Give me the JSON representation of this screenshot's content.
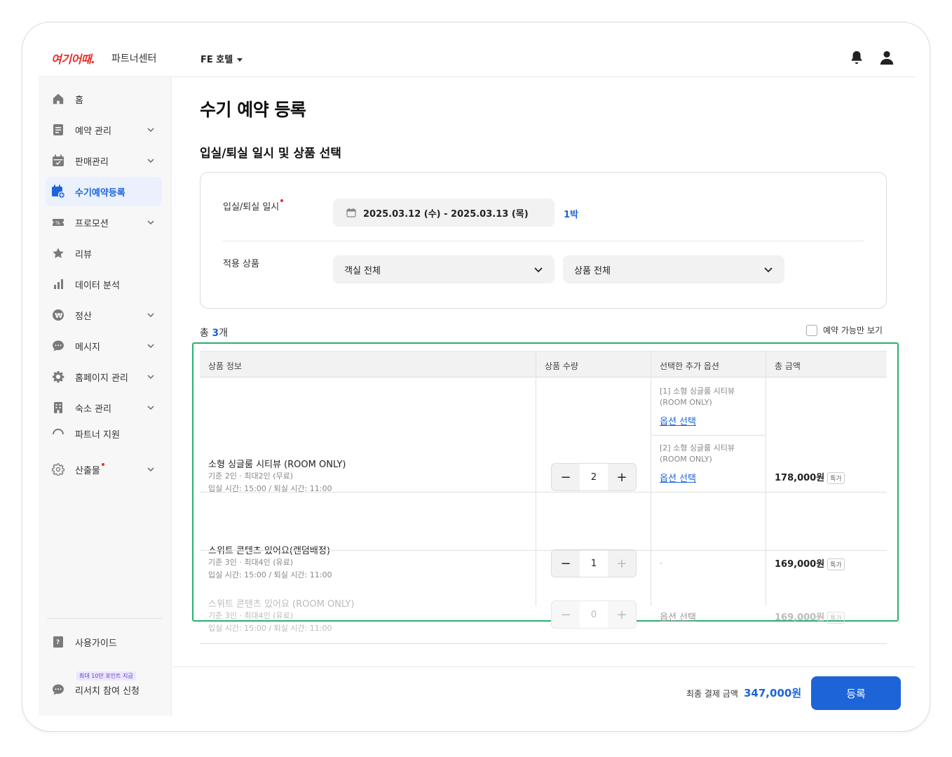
{
  "header": {
    "logo": "여기어때.",
    "logo_sub": "파트너센터",
    "hotel": "FE 호텔"
  },
  "sidebar": {
    "items": [
      {
        "label": "홈"
      },
      {
        "label": "예약 관리"
      },
      {
        "label": "판매관리"
      },
      {
        "label": "수기예약등록"
      },
      {
        "label": "프로모션"
      },
      {
        "label": "리뷰"
      },
      {
        "label": "데이터 분석"
      },
      {
        "label": "정산"
      },
      {
        "label": "메시지"
      },
      {
        "label": "홈페이지 관리"
      },
      {
        "label": "숙소 관리"
      },
      {
        "label": "파트너 지원"
      },
      {
        "label": "산출물"
      }
    ],
    "guide": "사용가이드",
    "promo_badge": "최대 10만 포인트 지급",
    "research": "리서치 참여 신청"
  },
  "main": {
    "title": "수기 예약 등록",
    "section_title": "입실/퇴실 일시 및 상품 선택",
    "date_label": "입실/퇴실 일시",
    "date_value": "2025.03.12 (수) - 2025.03.13 (목)",
    "nights": "1박",
    "product_label": "적용 상품",
    "room_select": "객실 전체",
    "product_select": "상품 전체",
    "count_prefix": "총 ",
    "count_value": "3",
    "count_suffix": "개",
    "avail_only": "예약 가능만 보기"
  },
  "table": {
    "headers": [
      "상품 정보",
      "상품 수량",
      "선택한 추가 옵션",
      "총 금액"
    ],
    "rows": [
      {
        "name": "소형 싱글룸 시티뷰 (ROOM ONLY)",
        "meta1": "기준 2인 · 최대2인 (무료)",
        "meta2": "입실 시간: 15:00 / 퇴실 시간: 11:00",
        "qty": "2",
        "options": [
          {
            "text": "[1] 소형 싱글룸 시티뷰 (ROOM ONLY)",
            "link": "옵션 선택"
          },
          {
            "text": "[2] 소형 싱글룸 시티뷰 (ROOM ONLY)",
            "link": "옵션 선택"
          }
        ],
        "price": "178,000원",
        "tag": "특가"
      },
      {
        "name": "스위트 콘텐츠 있어요(랜덤배정)",
        "meta1": "기준 3인 · 최대4인 (유료)",
        "meta2": "입실 시간: 15:00 / 퇴실 시간: 11:00",
        "qty": "1",
        "option_none": "-",
        "price": "169,000원",
        "tag": "특가"
      },
      {
        "name": "스위트 콘텐츠 있어요 (ROOM ONLY)",
        "meta1": "기준 3인 · 최대4인 (유료)",
        "meta2": "입실 시간: 15:00 / 퇴실 시간: 11:00",
        "qty": "0",
        "option_link": "옵션 선택",
        "price": "169,000원",
        "tag": "특가"
      }
    ]
  },
  "footer": {
    "total_label": "최종 결제 금액",
    "total_value": "347,000원",
    "submit": "등록"
  },
  "colors": {
    "primary": "#1d64d8",
    "highlight": "#2ab06f",
    "brand": "#e0312d"
  }
}
